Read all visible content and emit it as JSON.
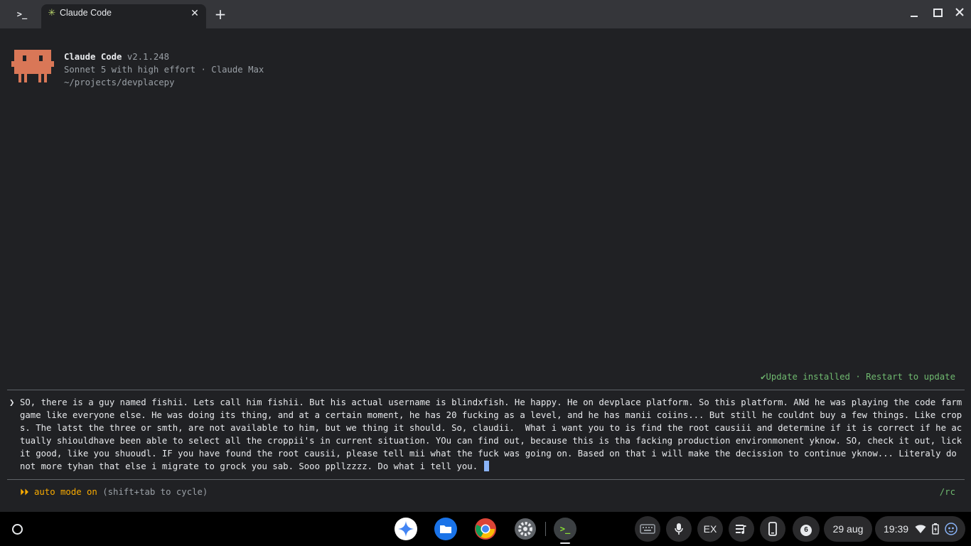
{
  "window": {
    "app_icon_glyph": ">_",
    "tab_favicon_glyph": "✳",
    "tab_title": "Claude Code",
    "tab_close_glyph": "✕",
    "new_tab_glyph": "+"
  },
  "header": {
    "name": "Claude Code",
    "version": "v2.1.248",
    "model": "Sonnet 5 with high effort · Claude Max",
    "path": "~/projects/devplacepy",
    "logo_color": "#d97757"
  },
  "status": {
    "update_message": "✔Update installed · Restart to update",
    "update_color": "#6fb96f"
  },
  "prompt": {
    "glyph": "❯",
    "text": "SO, there is a guy named fishii. Lets call him fishii. But his actual username is blindxfish. He happy. He on devplace platform. So this platform. ANd he was playing the code farm game like everyone else. He was doing its thing, and at a certain moment, he has 20 fucking as a level, and he has manii coiins... But still he couldnt buy a few things. Like crops. The latst the three or smth, are not available to him, but we thing it should. So, claudii.  What i want you to is find the root causiii and determine if it is correct if he actually shiouldhave been able to select all the croppii's in current situation. YOu can find out, because this is tha facking production environmonent yknow. SO, check it out, lick it good, like you shuoudl. IF you have found the root causii, please tell mii what the fuck was going on. Based on that i will make the decission to continue yknow... Literaly do not more tyhan that else i migrate to grock you sab. Sooo ppllzzzz. Do what i tell you. "
  },
  "footer": {
    "mode_arrows": "⏵⏵",
    "mode_label": "auto mode on",
    "mode_hint": "(shift+tab to cycle)",
    "rc_label": "/rc",
    "accent_color": "#f9ab00"
  },
  "shelf": {
    "apps": [
      "gemini-icon",
      "files-icon",
      "chrome-icon",
      "settings-icon",
      "terminal-icon"
    ],
    "terminal_glyph": ">_",
    "ime_label": "EX",
    "notification_count": "6",
    "date": "29 aug",
    "time": "19:39"
  }
}
